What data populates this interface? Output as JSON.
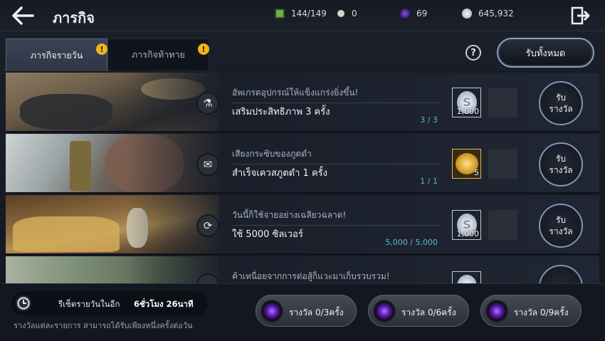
{
  "header": {
    "title": "ภารกิจ",
    "resources": [
      {
        "icon": "stamina-icon",
        "value": "144/149",
        "color": "#6fae4a"
      },
      {
        "icon": "pearl-icon",
        "value": "0",
        "color": "#d8d3cc"
      },
      {
        "icon": "dark-crystal-icon",
        "value": "69",
        "color": "#5b2aa0"
      },
      {
        "icon": "silver-coin-icon",
        "value": "645,932",
        "color": "#c9d3de"
      }
    ]
  },
  "tabs": [
    {
      "label": "ภารกิจรายวัน",
      "active": true,
      "alert": "!"
    },
    {
      "label": "ภารกิจท้าทาย",
      "active": false,
      "alert": "!"
    }
  ],
  "toolbar": {
    "help": "?",
    "claim_all": "รับทั้งหมด"
  },
  "quests": [
    {
      "subtitle": "อัพเกรดอุปกรณ์ให้แข็งแกร่งยิ่งขึ้น!",
      "title": "เสริมประสิทธิภาพ 3 ครั้ง",
      "progress": "3 / 3",
      "reward_icon": "silver-coin-icon",
      "reward_count": "1,000",
      "button_line1": "รับ",
      "button_line2": "รางวัล"
    },
    {
      "subtitle": "เสียงกระซิบของภูตดำ",
      "title": "สำเร็จเควสภูตดำ 1 ครั้ง",
      "progress": "1 / 1",
      "reward_icon": "gold-bar-icon",
      "reward_count": "5",
      "button_line1": "รับ",
      "button_line2": "รางวัล"
    },
    {
      "subtitle": "วันนี้ก็ใช้จ่ายอย่างเฉลียวฉลาด!",
      "title": "ใช้ 5000 ซิลเวอร์",
      "progress": "5,000 / 5,000",
      "reward_icon": "silver-coin-icon",
      "reward_count": "1,000",
      "button_line1": "รับ",
      "button_line2": "รางวัล"
    },
    {
      "subtitle": "ค้าเหนื่อยจากการต่อสู้ก็แวะมาเก็บรวบรวม!",
      "title": "",
      "progress": "",
      "reward_icon": "silver-coin-icon",
      "reward_count": "",
      "button_line1": "",
      "button_line2": ""
    }
  ],
  "footer": {
    "reset_label": "รีเซ็ตรายวันในอีก",
    "reset_time": "6ชั่วโมง 26นาที",
    "note": "รางวัลแต่ละรายการ สามารถได้รับเพียงหนึ่งครั้งต่อวัน",
    "bonuses": [
      "รางวัล 0/3ครั้ง",
      "รางวัล 0/6ครั้ง",
      "รางวัล 0/9ครั้ง"
    ]
  }
}
